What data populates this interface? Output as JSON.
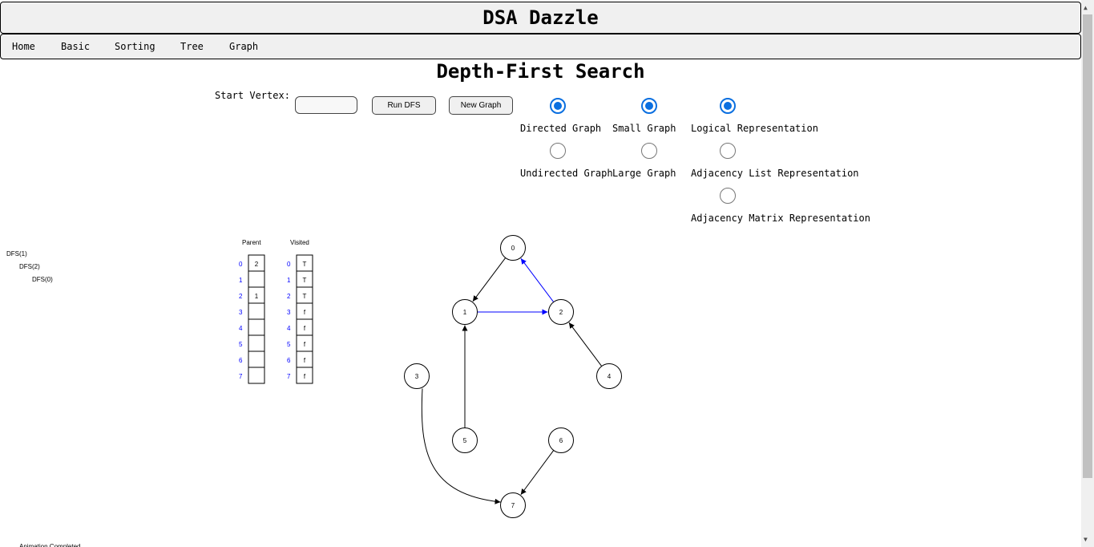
{
  "header": {
    "title": "DSA Dazzle"
  },
  "nav": {
    "items": [
      "Home",
      "Basic",
      "Sorting",
      "Tree",
      "Graph"
    ]
  },
  "page": {
    "title": "Depth-First Search"
  },
  "controls": {
    "start_vertex_label": "Start Vertex:",
    "start_vertex_value": "",
    "run_label": "Run DFS",
    "new_graph_label": "New Graph"
  },
  "options": {
    "direction": [
      {
        "label": "Directed Graph",
        "selected": true
      },
      {
        "label": "Undirected Graph",
        "selected": false
      }
    ],
    "size": [
      {
        "label": "Small Graph",
        "selected": true
      },
      {
        "label": "Large Graph",
        "selected": false
      }
    ],
    "representation": [
      {
        "label": "Logical Representation",
        "selected": true
      },
      {
        "label": "Adjacency List Representation",
        "selected": false
      },
      {
        "label": "Adjacency Matrix Representation",
        "selected": false
      }
    ]
  },
  "trace": [
    "DFS(1)",
    "DFS(2)",
    "DFS(0)"
  ],
  "parent_table": {
    "title": "Parent",
    "indices": [
      "0",
      "1",
      "2",
      "3",
      "4",
      "5",
      "6",
      "7"
    ],
    "values": [
      "2",
      "",
      "1",
      "",
      "",
      "",
      "",
      ""
    ]
  },
  "visited_table": {
    "title": "Visited",
    "indices": [
      "0",
      "1",
      "2",
      "3",
      "4",
      "5",
      "6",
      "7"
    ],
    "values": [
      "T",
      "T",
      "T",
      "f",
      "f",
      "f",
      "f",
      "f"
    ]
  },
  "graph": {
    "vertices": [
      "0",
      "1",
      "2",
      "3",
      "4",
      "5",
      "6",
      "7"
    ],
    "edges": [
      {
        "from": "0",
        "to": "1",
        "highlighted": false
      },
      {
        "from": "1",
        "to": "2",
        "highlighted": true
      },
      {
        "from": "2",
        "to": "0",
        "highlighted": true
      },
      {
        "from": "4",
        "to": "2",
        "highlighted": false
      },
      {
        "from": "5",
        "to": "1",
        "highlighted": false
      },
      {
        "from": "3",
        "to": "7",
        "highlighted": false
      },
      {
        "from": "6",
        "to": "7",
        "highlighted": false
      }
    ],
    "highlight_color": "#0000ff",
    "edge_color": "#000000",
    "index_color": "#0000ff"
  },
  "status": {
    "message": "Animation Completed"
  }
}
